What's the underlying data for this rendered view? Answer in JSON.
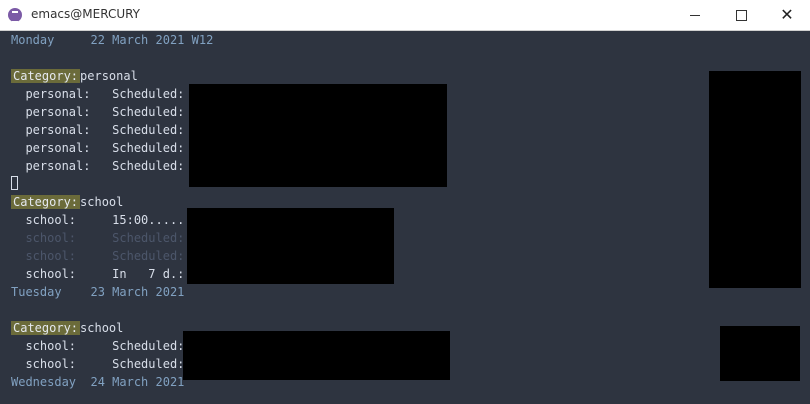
{
  "window": {
    "title": "emacs@MERCURY"
  },
  "agenda": {
    "day1_header": "Monday     22 March 2021 W12",
    "category_label": "Category:",
    "group1_category": "personal",
    "group1_rows": [
      "  personal:   Scheduled:",
      "  personal:   Scheduled:",
      "  personal:   Scheduled:",
      "  personal:   Scheduled:",
      "  personal:   Scheduled:"
    ],
    "group2_category": "school",
    "group2_rows": [
      "  school:     15:00......",
      "  school:     Scheduled:",
      "  school:     Scheduled:",
      "  school:     In   7 d.:"
    ],
    "day2_header": "Tuesday    23 March 2021",
    "group3_category": "school",
    "group3_rows": [
      "  school:     Scheduled:",
      "  school:     Scheduled:"
    ],
    "day3_header": "Wednesday  24 March 2021"
  }
}
